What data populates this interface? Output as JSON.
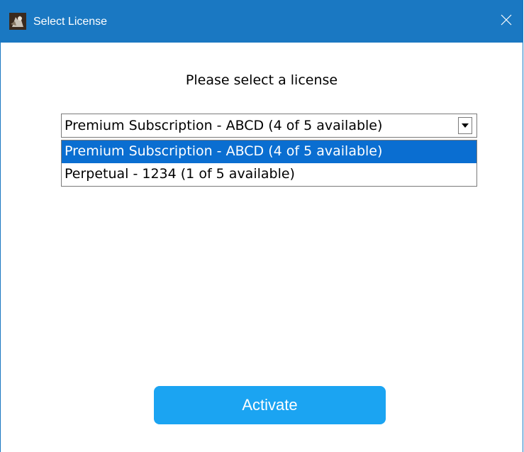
{
  "window": {
    "title": "Select License",
    "app_icon": "app-logo-icon",
    "close_icon": "close-icon"
  },
  "prompt": "Please select a license",
  "license_select": {
    "selected_value": "Premium Subscription - ABCD (4 of 5 available)",
    "expanded": true,
    "options": [
      {
        "label": "Premium Subscription - ABCD (4 of 5 available)",
        "highlighted": true
      },
      {
        "label": "Perpetual - 1234  (1 of 5 available)",
        "highlighted": false
      }
    ]
  },
  "activate_button": {
    "label": "Activate"
  },
  "colors": {
    "titlebar": "#1a78c2",
    "selection_highlight": "#0a6ed1",
    "button": "#1ba4f2"
  }
}
